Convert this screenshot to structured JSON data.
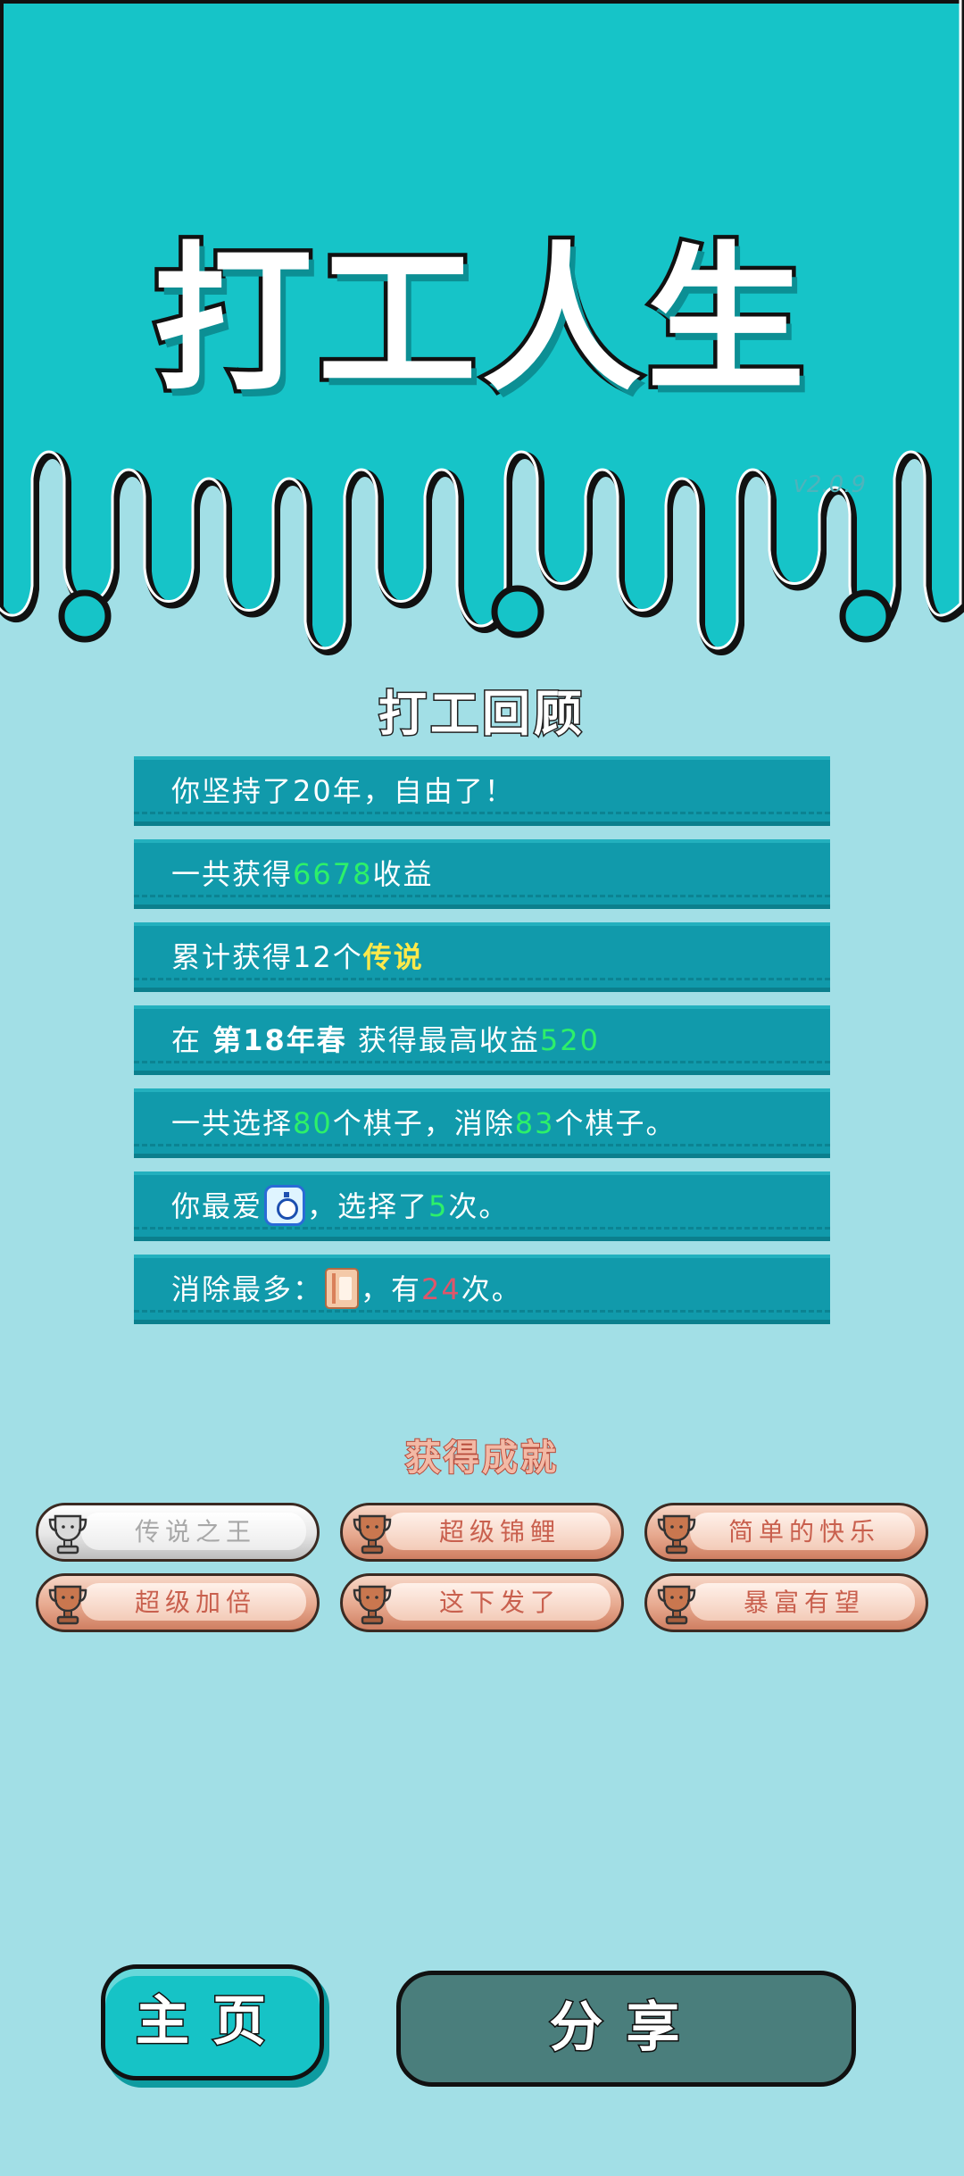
{
  "game": {
    "title": "打工人生",
    "version": "v2.0.9"
  },
  "colors": {
    "header": "#16c4c8",
    "background": "#a2dfe6",
    "row": "#119aab",
    "highlight_green": "#2df06a",
    "highlight_yellow": "#ffe94a",
    "highlight_red": "#e0556a"
  },
  "review": {
    "title": "打工回顾",
    "row1": {
      "text": "你坚持了20年，自由了！"
    },
    "row2": {
      "pre": "一共获得",
      "value": "6678",
      "post": "收益"
    },
    "row3": {
      "pre": "累计获得12个",
      "value": "传说"
    },
    "row4": {
      "pre": "在",
      "when": "第18年春",
      "mid": "获得最高收益",
      "value": "520"
    },
    "row5": {
      "pre": "一共选择",
      "value1": "80",
      "mid": "个棋子，消除",
      "value2": "83",
      "post": "个棋子。"
    },
    "row6": {
      "pre": "你最爱",
      "icon": "stopwatch-icon",
      "mid": "，选择了",
      "value": "5",
      "post": "次。"
    },
    "row7": {
      "pre": "消除最多：",
      "icon": "book-icon",
      "mid": "，有",
      "value": "24",
      "post": "次。"
    }
  },
  "achievements": {
    "title": "获得成就",
    "items": [
      {
        "label": "传说之王",
        "tier": "silver",
        "icon": "trophy-icon"
      },
      {
        "label": "超级锦鲤",
        "tier": "bronze",
        "icon": "trophy-icon"
      },
      {
        "label": "简单的快乐",
        "tier": "bronze",
        "icon": "trophy-icon"
      },
      {
        "label": "超级加倍",
        "tier": "bronze",
        "icon": "trophy-icon"
      },
      {
        "label": "这下发了",
        "tier": "bronze",
        "icon": "trophy-icon"
      },
      {
        "label": "暴富有望",
        "tier": "bronze",
        "icon": "trophy-icon"
      }
    ]
  },
  "buttons": {
    "home_label": "主页",
    "share_label": "分享"
  }
}
